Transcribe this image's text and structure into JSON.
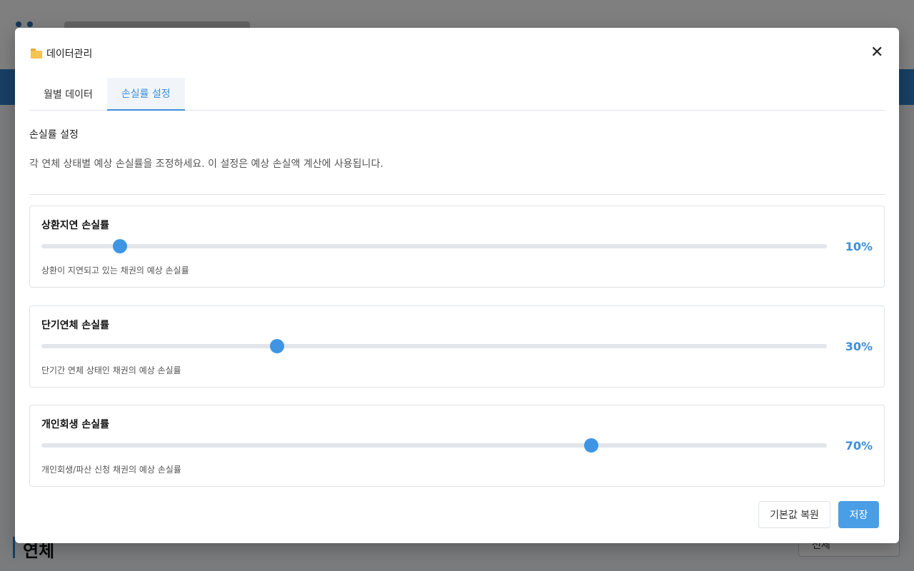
{
  "background": {
    "section_title": "연체",
    "select_value": "전체"
  },
  "modal": {
    "title": "데이터관리",
    "icon": "folder-icon",
    "close_icon": "close-icon"
  },
  "tabs": [
    {
      "label": "월별 데이터",
      "active": false
    },
    {
      "label": "손실률 설정",
      "active": true
    }
  ],
  "settings": {
    "title": "손실률 설정",
    "description": "각 연체 상태별 예상 손실률을 조정하세요. 이 설정은 예상 손실액 계산에 사용됩니다."
  },
  "cards": [
    {
      "title": "상환지연 손실률",
      "value": 10,
      "value_label": "10%",
      "description": "상환이 지연되고 있는 채권의 예상 손실률"
    },
    {
      "title": "단기연체 손실률",
      "value": 30,
      "value_label": "30%",
      "description": "단기간 연체 상태인 채권의 예상 손실률"
    },
    {
      "title": "개인회생 손실률",
      "value": 70,
      "value_label": "70%",
      "description": "개인회생/파산 신청 채권의 예상 손실률"
    }
  ],
  "buttons": {
    "reset": "기본값 복원",
    "save": "저장"
  },
  "colors": {
    "accent": "#3d8fd9",
    "slider_thumb": "#3f95e3",
    "save_button": "#4a9ee6"
  }
}
